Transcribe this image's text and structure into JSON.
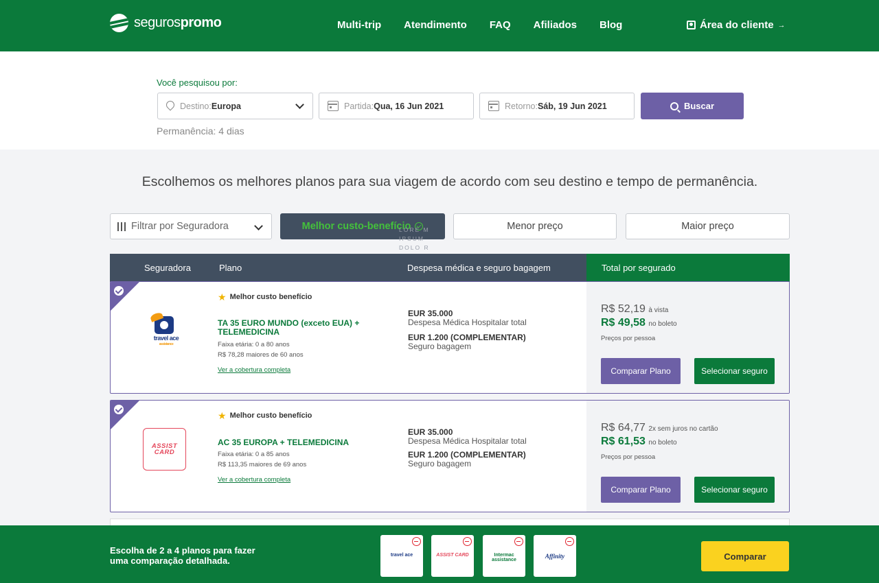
{
  "header": {
    "logo_part1": "seguros",
    "logo_part2": "promo",
    "nav": [
      "Multi-trip",
      "Atendimento",
      "FAQ",
      "Afiliados",
      "Blog"
    ],
    "client_label": "Área do cliente",
    "client_arrow": "→"
  },
  "search": {
    "label": "Você pesquisou por:",
    "destination_label": "Destino:",
    "destination_value": "Europa",
    "departure_label": "Partida:",
    "departure_value": "Qua, 16 Jun 2021",
    "return_label": "Retorno:",
    "return_value": "Sáb, 19 Jun 2021",
    "button_label": "Buscar",
    "stay_text": "Permanência: 4 dias"
  },
  "content": {
    "headline": "Escolhemos os melhores planos para sua viagem de acordo com seu destino e tempo de permanência.",
    "filter_label": "Filtrar por Seguradora",
    "sort_best": "Melhor custo-benefício",
    "sort_low": "Menor preço",
    "sort_high": "Maior preço",
    "lorem": "LORE M IPSUM DOLO R SIT"
  },
  "table": {
    "col_insurer": "Seguradora",
    "col_plan": "Plano",
    "col_coverage": "Despesa médica e seguro bagagem",
    "col_total": "Total por segurado"
  },
  "plans": [
    {
      "badge": "Melhor custo benefício",
      "insurer_logo": "travel ace",
      "insurer_logo_sub": "assistance",
      "name": "TA 35 EURO MUNDO (exceto EUA) + TELEMEDICINA",
      "age_range": "Faixa etária: 0 a 80 anos",
      "senior_price": "R$ 78,28 maiores de 60 anos",
      "link": "Ver a cobertura completa",
      "medical_value": "EUR 35.000",
      "medical_label": "Despesa Médica Hospitalar total",
      "baggage_value": "EUR 1.200 (COMPLEMENTAR)",
      "baggage_label": "Seguro bagagem",
      "price_main": "R$ 52,19",
      "price_main_note": "à vista",
      "price_boleto": "R$ 49,58",
      "price_boleto_note": "no boleto",
      "price_per_person": "Preços por pessoa",
      "compare_label": "Comparar Plano",
      "select_label": "Selecionar seguro"
    },
    {
      "badge": "Melhor custo benefício",
      "insurer_logo": "ASSIST CARD",
      "name": "AC 35 EUROPA + TELEMEDICINA",
      "age_range": "Faixa etária: 0 a 85 anos",
      "senior_price": "R$ 113,35 maiores de 69 anos",
      "link": "Ver a cobertura completa",
      "medical_value": "EUR 35.000",
      "medical_label": "Despesa Médica Hospitalar total",
      "baggage_value": "EUR 1.200 (COMPLEMENTAR)",
      "baggage_label": "Seguro bagagem",
      "price_main": "R$ 64,77",
      "price_main_note": "2x sem juros no cartão",
      "price_boleto": "R$ 61,53",
      "price_boleto_note": "no boleto",
      "price_per_person": "Preços por pessoa",
      "compare_label": "Comparar Plano",
      "select_label": "Selecionar seguro"
    }
  ],
  "compare_bar": {
    "text": "Escolha de 2 a 4 planos para fazer uma comparação detalhada.",
    "selected_logos": [
      "travel ace",
      "ASSIST CARD",
      "Intermac assistance",
      "Affinity"
    ],
    "button_label": "Comparar"
  }
}
